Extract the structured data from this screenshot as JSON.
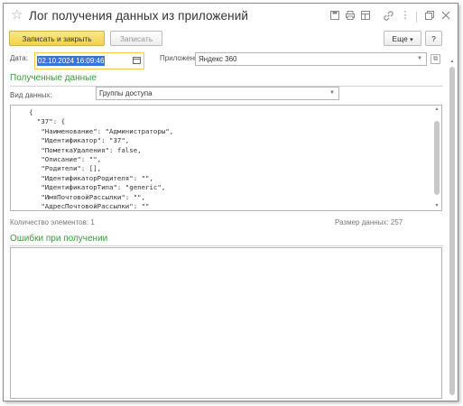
{
  "window": {
    "title": "Лог получения данных из приложений"
  },
  "toolbar": {
    "save_close_label": "Записать и закрыть",
    "save_label": "Записать",
    "more_label": "Еще",
    "more_chevron": "▾",
    "help_label": "?"
  },
  "form": {
    "date_label": "Дата:",
    "date_value": "02.10.2024 16:09:46",
    "app_label": "Приложение:",
    "app_value": "Яндекс 360",
    "received_section": "Полученные данные",
    "data_type_label": "Вид данных:",
    "data_type_value": "Группы доступа",
    "json_lines": [
      "{",
      "  \"37\": {",
      "   \"Наименование\": \"Администраторы\",",
      "   \"Идентификатор\": \"37\",",
      "   \"ПометкаУдаления\": false,",
      "   \"Описание\": \"\",",
      "   \"Родители\": [],",
      "   \"ИдентификаторРодителя\": \"\",",
      "   \"ИдентификаторТипа\": \"generic\",",
      "   \"ИмяПочтовойРассылки\": \"\",",
      "   \"АдресПочтовойРассылки\": \"\""
    ],
    "count_label": "Количество элементов:",
    "count_value": "1",
    "size_label": "Размер данных:",
    "size_value": "257",
    "errors_section": "Ошибки при получении"
  },
  "icons": {
    "star": "star-icon",
    "save": "save-icon",
    "print": "print-icon",
    "table": "table-icon",
    "link": "link-icon",
    "more": "more-icon",
    "restore": "restore-icon",
    "close": "close-icon",
    "calendar": "calendar-icon",
    "dropdown": "chevron-down-icon",
    "open": "open-icon"
  },
  "colors": {
    "primary_button": "#f4d24a",
    "section_title": "#3a9a3a",
    "date_focus": "#f2c94c",
    "selection": "#3875d7"
  }
}
